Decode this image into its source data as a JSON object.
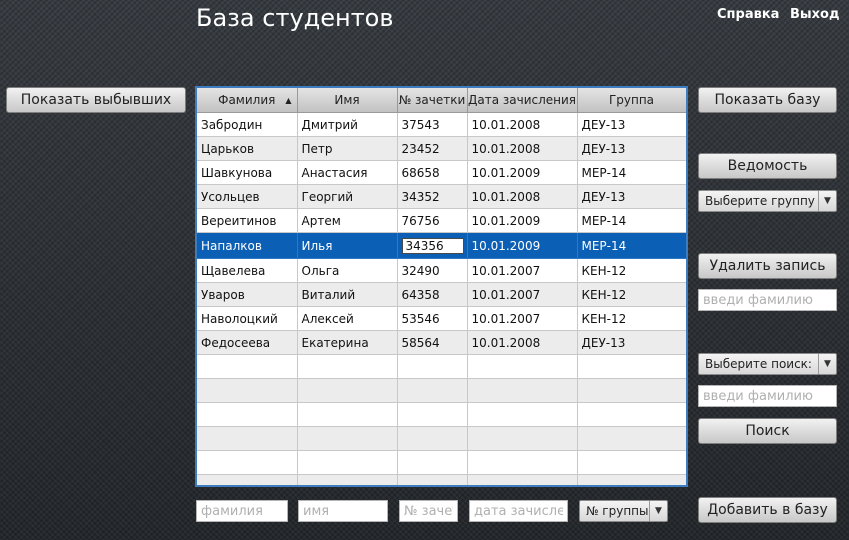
{
  "header": {
    "title": "База студентов",
    "help_link": "Справка",
    "exit_link": "Выход"
  },
  "left": {
    "show_dropped_button": "Показать выбывших"
  },
  "table": {
    "columns": [
      "Фамилия",
      "Имя",
      "№ зачетки",
      "Дата зачисления",
      "Группа"
    ],
    "sort_icon": "▲",
    "rows": [
      [
        "Забродин",
        "Дмитрий",
        "37543",
        "10.01.2008",
        "ДЕУ-13"
      ],
      [
        "Царьков",
        "Петр",
        "23452",
        "10.01.2008",
        "ДЕУ-13"
      ],
      [
        "Шавкунова",
        "Анастасия",
        "68658",
        "10.01.2009",
        "МЕР-14"
      ],
      [
        "Усольцев",
        "Георгий",
        "34352",
        "10.01.2008",
        "ДЕУ-13"
      ],
      [
        "Вереитинов",
        "Артем",
        "76756",
        "10.01.2009",
        "МЕР-14"
      ],
      [
        "Напалков",
        "Илья",
        "34356",
        "10.01.2009",
        "МЕР-14"
      ],
      [
        "Щавелева",
        "Ольга",
        "32490",
        "10.01.2007",
        "КЕН-12"
      ],
      [
        "Уваров",
        "Виталий",
        "64358",
        "10.01.2007",
        "КЕН-12"
      ],
      [
        "Наволоцкий",
        "Алексей",
        "53546",
        "10.01.2007",
        "КЕН-12"
      ],
      [
        "Федосеева",
        "Екатерина",
        "58564",
        "10.01.2008",
        "ДЕУ-13"
      ]
    ],
    "empty_rows": 6
  },
  "right": {
    "show_base_button": "Показать базу",
    "statement_button": "Ведомость",
    "group_select": "Выберите группу",
    "delete_button": "Удалить запись",
    "delete_input_placeholder": "введи фамилию",
    "search_select": "Выберите поиск:",
    "search_input_placeholder": "введи фамилию",
    "search_button": "Поиск",
    "add_button": "Добавить в базу"
  },
  "bottom": {
    "surname_placeholder": "фамилия",
    "name_placeholder": "имя",
    "record_placeholder": "№ зачетки",
    "date_placeholder": "дата зачисления",
    "group_select": "№ группы"
  },
  "icons": {
    "dropdown_arrow": "▼"
  }
}
